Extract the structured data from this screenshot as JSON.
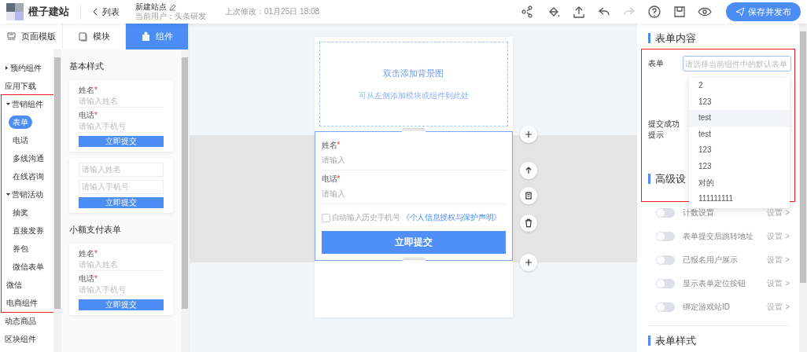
{
  "topbar": {
    "brand": "橙子建站",
    "back": "列表",
    "site_title": "新建站点",
    "current_user": "当前用户：头条研发",
    "last_modified": "上次修改：01月25日 18:08",
    "tools": [
      {
        "kind": "share",
        "disabled": false
      },
      {
        "kind": "paint",
        "disabled": false
      },
      {
        "kind": "upload",
        "disabled": false
      },
      {
        "kind": "undo",
        "disabled": false
      },
      {
        "kind": "redo",
        "disabled": true
      },
      {
        "kind": "help",
        "disabled": false
      },
      {
        "kind": "save",
        "disabled": false
      },
      {
        "kind": "preview",
        "disabled": false
      }
    ],
    "publish": "保存并发布"
  },
  "tabs": [
    {
      "label": "页面模版",
      "kind": "page",
      "selected": false
    },
    {
      "label": "模块",
      "kind": "module",
      "selected": false
    },
    {
      "label": "组件",
      "kind": "component",
      "selected": true
    }
  ],
  "nav": {
    "items": [
      {
        "label": "预约组件",
        "expanded": false
      },
      {
        "label": "应用下载"
      }
    ],
    "highlighted": true,
    "highlight_items": [
      {
        "label": "营销组件",
        "expanded": true,
        "children": [
          {
            "label": "表单",
            "selected": true
          },
          {
            "label": "电话",
            "selected": false
          },
          {
            "label": "多线沟通",
            "selected": false
          },
          {
            "label": "在线咨询",
            "selected": false
          }
        ]
      },
      {
        "label": "营销活动",
        "expanded": true,
        "children": [
          {
            "label": "抽奖",
            "selected": false
          },
          {
            "label": "直接发券",
            "selected": false
          },
          {
            "label": "券包",
            "selected": false
          },
          {
            "label": "微信表单",
            "selected": false
          }
        ]
      },
      {
        "label": "微信"
      },
      {
        "label": "电商组件"
      }
    ],
    "after_items": [
      {
        "label": "动态商品"
      },
      {
        "label": "区块组件"
      }
    ]
  },
  "templates": [
    {
      "heading": "基本样式",
      "cards": [
        {
          "fields": [
            {
              "label": "姓名",
              "required_mark": "*",
              "placeholder": "请输入姓名"
            },
            {
              "label": "电话",
              "required_mark": "*",
              "placeholder": "请输入手机号"
            }
          ],
          "button": "立即提交"
        },
        {
          "fields": [
            {
              "placeholder": "请输入姓名"
            },
            {
              "placeholder": "请输入手机号"
            }
          ],
          "button": "立即提交"
        }
      ]
    },
    {
      "heading": "小额支付表单",
      "cards": [
        {
          "fields": [
            {
              "label": "姓名",
              "required_mark": "*",
              "placeholder": "请输入姓名"
            },
            {
              "label": "电话",
              "required_mark": "*",
              "placeholder": "请输入手机号"
            }
          ],
          "button": "立即提交"
        }
      ]
    }
  ],
  "canvas": {
    "bg_title": "双击添加背景图",
    "bg_hint": "可从左侧添加模块或组件到此处",
    "form": {
      "fields": [
        {
          "label": "姓名",
          "required_mark": "*",
          "placeholder": "请输入"
        },
        {
          "label": "电话",
          "required_mark": "*",
          "placeholder": "请输入"
        }
      ],
      "autofill": {
        "checked": false,
        "label": "自动输入历史手机号",
        "link": "《个人信息授权与保护声明》"
      },
      "button": "立即提交"
    },
    "side_actions": [
      {
        "kind": "add"
      },
      {
        "kind": "up"
      },
      {
        "kind": "copy"
      },
      {
        "kind": "delete"
      },
      {
        "kind": "add"
      }
    ]
  },
  "panel": {
    "section_title": "表单内容",
    "highlighted": true,
    "form_label": "表单",
    "form_placeholder": "请选择当前组件中的默认表单",
    "success_label": "提交成功提示",
    "dropdown": [
      {
        "label": "2",
        "hovered": false
      },
      {
        "label": "123",
        "hovered": false
      },
      {
        "label": "test",
        "hovered": true
      },
      {
        "label": "test",
        "hovered": false
      },
      {
        "label": "123",
        "hovered": false
      },
      {
        "label": "123",
        "hovered": false
      },
      {
        "label": "对的",
        "hovered": false
      },
      {
        "label": "111111111",
        "hovered": false
      }
    ],
    "advanced_title": "高级设",
    "toggles": [
      {
        "label": "计数设置",
        "on": false,
        "action": "设置 >"
      },
      {
        "label": "表单提交后跳转地址",
        "on": false,
        "action": "设置 >"
      },
      {
        "label": "已报名用户展示",
        "on": false,
        "action": "设置 >"
      },
      {
        "label": "显示表单定位按钮",
        "on": false,
        "action": "设置 >"
      },
      {
        "label": "绑定游戏站ID",
        "on": false,
        "action": "设置 >"
      }
    ],
    "style_title": "表单样式"
  }
}
